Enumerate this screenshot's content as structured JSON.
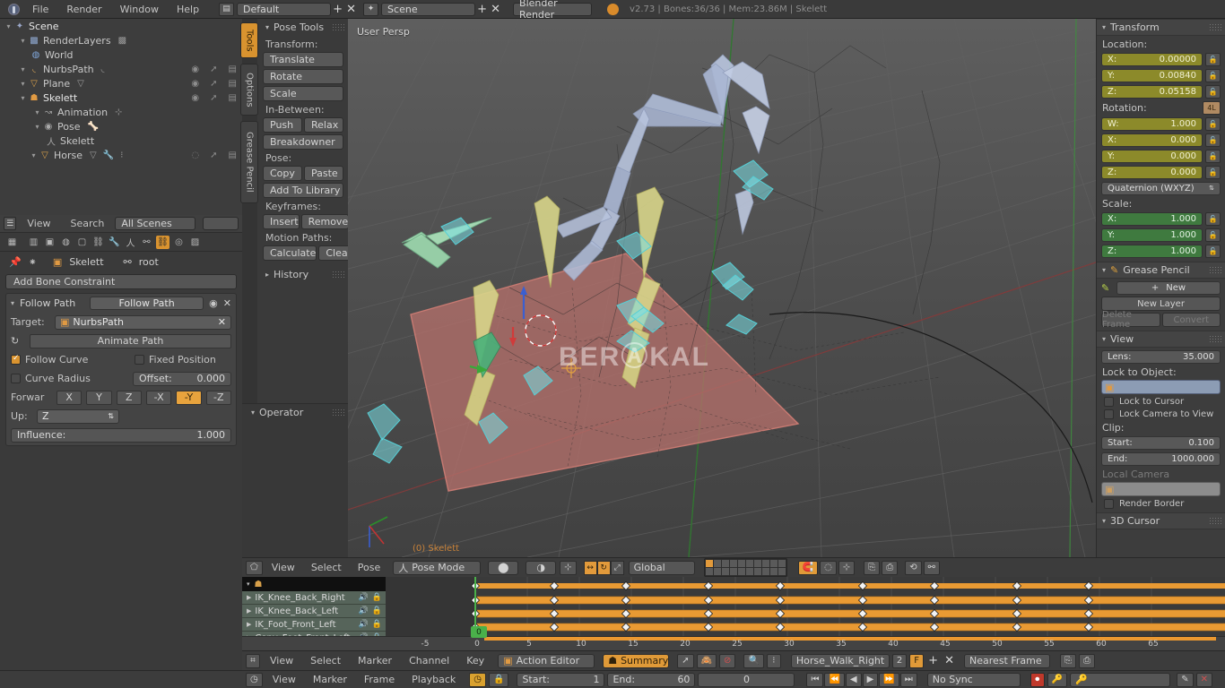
{
  "topbar": {
    "logo_icon": "blender-logo-icon",
    "menus": [
      "File",
      "Render",
      "Window",
      "Help"
    ],
    "screen_layout_icon": "screen-layout-icon",
    "screen_layout": "Default",
    "add_label": "+",
    "close_label": "✕",
    "scene_icon": "scene-icon",
    "scene_name": "Scene",
    "engine": "Blender Render",
    "status": "v2.73 | Bones:36/36 | Mem:23.86M | Skelett"
  },
  "outliner": {
    "items": [
      {
        "label": "Scene",
        "icon": "scene-icon",
        "depth": 0,
        "expanded": true,
        "controls": false
      },
      {
        "label": "RenderLayers",
        "icon": "renderlayer-icon",
        "depth": 1,
        "expanded": true,
        "controls": false
      },
      {
        "label": "World",
        "icon": "world-icon",
        "depth": 1,
        "expanded": null,
        "controls": false
      },
      {
        "label": "NurbsPath",
        "icon": "curve-icon",
        "depth": 1,
        "expanded": true,
        "controls": true
      },
      {
        "label": "Plane",
        "icon": "mesh-icon",
        "depth": 1,
        "expanded": true,
        "controls": true
      },
      {
        "label": "Skelett",
        "icon": "armature-object-icon",
        "depth": 1,
        "expanded": true,
        "controls": true
      },
      {
        "label": "Animation",
        "icon": "animation-icon",
        "depth": 2,
        "expanded": true,
        "controls": false
      },
      {
        "label": "Pose",
        "icon": "pose-icon",
        "depth": 2,
        "expanded": true,
        "controls": false
      },
      {
        "label": "Skelett",
        "icon": "armature-data-icon",
        "depth": 3,
        "expanded": null,
        "controls": false
      },
      {
        "label": "Horse",
        "icon": "mesh-icon",
        "depth": 2,
        "expanded": true,
        "controls": true
      }
    ]
  },
  "properties": {
    "header": {
      "editor_icon": "outliner-editor-icon",
      "menus": [
        "View",
        "Search"
      ],
      "scope": "All Scenes"
    },
    "tab_icons": [
      "render-tab-icon",
      "render-layers-tab-icon",
      "scene-tab-icon",
      "world-tab-icon",
      "object-tab-icon",
      "constraint-tab-icon",
      "modifier-tab-icon",
      "armature-data-tab-icon",
      "bone-tab-icon",
      "bone-constraint-tab-icon",
      "material-tab-icon",
      "texture-tab-icon"
    ],
    "active_tab_index": 9,
    "breadcrumb": {
      "object_icon": "object-icon",
      "object": "Skelett",
      "bone_icon": "bone-icon",
      "bone": "root"
    },
    "add_constraint_label": "Add Bone Constraint",
    "constraint": {
      "expand_icon": "chevron-down-icon",
      "type": "Follow Path",
      "name": "Follow Path",
      "eye_icon": "eye-icon",
      "delete_icon": "close-icon",
      "target_label": "Target:",
      "target_icon": "object-icon",
      "target_value": "NurbsPath",
      "animate_path_label": "Animate Path",
      "animate_path_icon": "curve-anim-icon",
      "follow_curve_label": "Follow Curve",
      "follow_curve_on": true,
      "fixed_position_label": "Fixed Position",
      "fixed_position_on": false,
      "curve_radius_label": "Curve Radius",
      "curve_radius_on": false,
      "offset_label": "Offset:",
      "offset_value": "0.000",
      "forward_label": "Forwar",
      "forward_options": [
        "X",
        "Y",
        "Z",
        "-X",
        "-Y",
        "-Z"
      ],
      "forward_selected": "-Y",
      "up_label": "Up:",
      "up_value": "Z",
      "influence_label": "Influence:",
      "influence_value": "1.000"
    }
  },
  "toolshelf": {
    "tabs": [
      {
        "label": "Tools",
        "active": true
      },
      {
        "label": "Options",
        "active": false
      },
      {
        "label": "Grease Pencil",
        "active": false
      }
    ],
    "panel_title": "Pose Tools",
    "sections": [
      {
        "heading": "Transform:",
        "buttons": [
          [
            "Translate"
          ],
          [
            "Rotate"
          ],
          [
            "Scale"
          ]
        ]
      },
      {
        "heading": "In-Between:",
        "buttons": [
          [
            "Push",
            "Relax"
          ],
          [
            "Breakdowner"
          ]
        ]
      },
      {
        "heading": "Pose:",
        "buttons": [
          [
            "Copy",
            "Paste"
          ],
          [
            "Add To Library"
          ]
        ]
      },
      {
        "heading": "Keyframes:",
        "buttons": [
          [
            "Insert",
            "Remove"
          ]
        ]
      },
      {
        "heading": "Motion Paths:",
        "buttons": [
          [
            "Calculate",
            "Clear"
          ]
        ]
      }
    ],
    "history_title": "History",
    "operator_title": "Operator"
  },
  "viewport": {
    "view_name": "User Persp",
    "status_text": "(0) Skelett",
    "watermark": "BERⒶKAL",
    "header": {
      "editor_icon": "3d-view-editor-icon",
      "menus": [
        "View",
        "Select",
        "Pose"
      ],
      "mode_icon": "pose-mode-icon",
      "mode": "Pose Mode",
      "shading_icon": "solid-shading-icon",
      "transform_orientation": "Global",
      "snap_icon": "snap-magnet-icon",
      "proportional_icon": "proportional-edit-icon",
      "pivot_icon": "pivot-icon"
    }
  },
  "npanel": {
    "transform": {
      "title": "Transform",
      "location_label": "Location:",
      "location": [
        {
          "axis": "X:",
          "value": "0.00000"
        },
        {
          "axis": "Y:",
          "value": "0.00840"
        },
        {
          "axis": "Z:",
          "value": "0.05158"
        }
      ],
      "rotation_label": "Rotation:",
      "rotation_toggle": "4L",
      "rotation": [
        {
          "axis": "W:",
          "value": "1.000"
        },
        {
          "axis": "X:",
          "value": "0.000"
        },
        {
          "axis": "Y:",
          "value": "0.000"
        },
        {
          "axis": "Z:",
          "value": "0.000"
        }
      ],
      "rotation_mode": "Quaternion (WXYZ)",
      "scale_label": "Scale:",
      "scale": [
        {
          "axis": "X:",
          "value": "1.000"
        },
        {
          "axis": "Y:",
          "value": "1.000"
        },
        {
          "axis": "Z:",
          "value": "1.000"
        }
      ]
    },
    "grease_pencil": {
      "title": "Grease Pencil",
      "pencil_icon": "pencil-icon",
      "new_label": "New",
      "new_layer_label": "New Layer",
      "delete_frame_label": "Delete Frame",
      "convert_label": "Convert"
    },
    "view": {
      "title": "View",
      "lens_label": "Lens:",
      "lens_value": "35.000",
      "lock_to_object_label": "Lock to Object:",
      "lock_object_icon": "object-icon",
      "lock_object_value": "",
      "lock_to_cursor_label": "Lock to Cursor",
      "lock_camera_label": "Lock Camera to View",
      "clip_label": "Clip:",
      "clip_start_label": "Start:",
      "clip_start_value": "0.100",
      "clip_end_label": "End:",
      "clip_end_value": "1000.000",
      "local_camera_label": "Local Camera",
      "local_camera_icon": "camera-icon",
      "local_camera_value": "",
      "render_border_label": "Render Border"
    },
    "cursor": {
      "title": "3D Cursor"
    }
  },
  "dopesheet": {
    "summary_icon": "armature-icon",
    "channels": [
      "IK_Knee_Back_Right",
      "IK_Knee_Back_Left",
      "IK_Foot_Front_Left",
      "Copy_Foot_Front_Left"
    ],
    "channel_icons": [
      "speaker-icon",
      "lock-icon"
    ],
    "ruler_ticks": [
      "-5",
      "0",
      "5",
      "10",
      "15",
      "20",
      "25",
      "30",
      "35",
      "40",
      "45",
      "50",
      "55",
      "60",
      "65"
    ],
    "current_frame": "0",
    "header": {
      "editor_icon": "dopesheet-editor-icon",
      "menus": [
        "View",
        "Select",
        "Marker",
        "Channel",
        "Key"
      ],
      "mode_icon": "action-icon",
      "mode": "Action Editor",
      "summary_label": "Summary",
      "summary_on": true,
      "action_icon": "action-icon",
      "action_name": "Horse_Walk_Right",
      "users_count": "2",
      "fake_user": "F",
      "add_label": "+",
      "close_label": "✕",
      "snap_value": "Nearest Frame"
    }
  },
  "timeline": {
    "editor_icon": "timeline-editor-icon",
    "menus": [
      "View",
      "Marker",
      "Frame",
      "Playback"
    ],
    "start_label": "Start:",
    "start_value": "1",
    "end_label": "End:",
    "end_value": "60",
    "current_value": "0",
    "sync_mode": "No Sync",
    "transport": [
      "jump-start-icon",
      "prev-keyframe-icon",
      "play-reverse-icon",
      "play-icon",
      "next-keyframe-icon",
      "jump-end-icon"
    ],
    "record_icon": "record-icon",
    "autokey_icon": "autokey-icon"
  }
}
